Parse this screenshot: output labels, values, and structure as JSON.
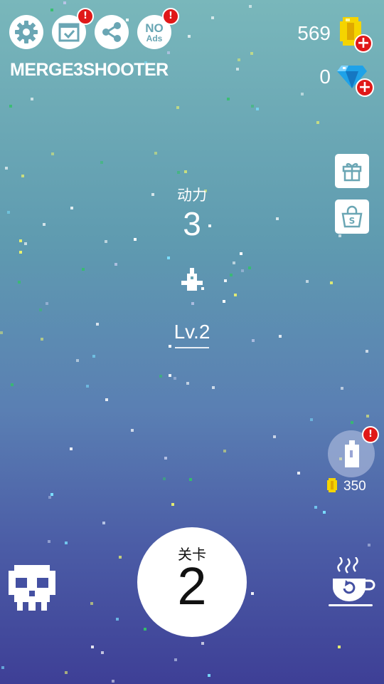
{
  "app": {
    "title": "MERGE3SHOOTER"
  },
  "toolbar": {
    "settings_icon": "gear-icon",
    "tasks_icon": "calendar-check-icon",
    "share_icon": "share-icon",
    "no_ads": {
      "line1": "NO",
      "line2": "Ads"
    },
    "badge_text": "!"
  },
  "currency": {
    "coins": "569",
    "gems": "0",
    "plus": "+"
  },
  "side_buttons": {
    "gift_icon": "gift-icon",
    "shop_icon": "shopping-bag-icon",
    "shop_letter": "S"
  },
  "power": {
    "label": "动力",
    "value": "3"
  },
  "ship": {
    "level": "Lv.2"
  },
  "stage": {
    "label": "关卡",
    "number": "2"
  },
  "bomb": {
    "cost": "350",
    "badge": "!"
  },
  "colors": {
    "badge_red": "#e01818",
    "coin_yellow": "#f5d400",
    "gem_blue": "#1fa2e8",
    "bg_top": "#79b7bb",
    "bg_bottom": "#3e3f96"
  }
}
